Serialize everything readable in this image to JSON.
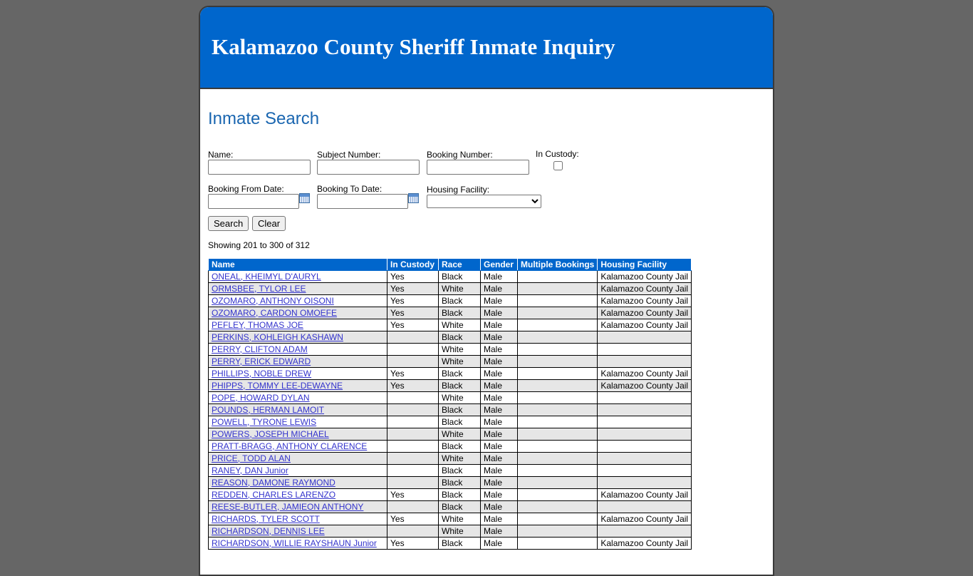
{
  "header": {
    "title": "Kalamazoo County Sheriff Inmate Inquiry"
  },
  "search": {
    "heading": "Inmate Search",
    "name_label": "Name:",
    "name_value": "",
    "subject_label": "Subject Number:",
    "subject_value": "",
    "booking_label": "Booking Number:",
    "booking_value": "",
    "custody_label": "In Custody:",
    "custody_checked": false,
    "from_label": "Booking From Date:",
    "from_value": "",
    "to_label": "Booking To Date:",
    "to_value": "",
    "facility_label": "Housing Facility:",
    "facility_selected": "",
    "search_button": "Search",
    "clear_button": "Clear",
    "calendar_icon": "calendar-icon"
  },
  "results": {
    "summary": "Showing 201 to 300 of 312",
    "columns": [
      "Name",
      "In Custody",
      "Race",
      "Gender",
      "Multiple Bookings",
      "Housing Facility"
    ],
    "rows": [
      {
        "name": "ONEAL, KHEIMYL D'AURYL",
        "custody": "Yes",
        "race": "Black",
        "gender": "Male",
        "multiple": "",
        "facility": "Kalamazoo County Jail"
      },
      {
        "name": "ORMSBEE, TYLOR LEE",
        "custody": "Yes",
        "race": "White",
        "gender": "Male",
        "multiple": "",
        "facility": "Kalamazoo County Jail"
      },
      {
        "name": "OZOMARO, ANTHONY OISONI",
        "custody": "Yes",
        "race": "Black",
        "gender": "Male",
        "multiple": "",
        "facility": "Kalamazoo County Jail"
      },
      {
        "name": "OZOMARO, CARDON OMOEFE",
        "custody": "Yes",
        "race": "Black",
        "gender": "Male",
        "multiple": "",
        "facility": "Kalamazoo County Jail"
      },
      {
        "name": "PEFLEY, THOMAS JOE",
        "custody": "Yes",
        "race": "White",
        "gender": "Male",
        "multiple": "",
        "facility": "Kalamazoo County Jail"
      },
      {
        "name": "PERKINS, KOHLEIGH KASHAWN",
        "custody": "",
        "race": "Black",
        "gender": "Male",
        "multiple": "",
        "facility": ""
      },
      {
        "name": "PERRY, CLIFTON ADAM",
        "custody": "",
        "race": "White",
        "gender": "Male",
        "multiple": "",
        "facility": ""
      },
      {
        "name": "PERRY, ERICK EDWARD",
        "custody": "",
        "race": "White",
        "gender": "Male",
        "multiple": "",
        "facility": ""
      },
      {
        "name": "PHILLIPS, NOBLE DREW",
        "custody": "Yes",
        "race": "Black",
        "gender": "Male",
        "multiple": "",
        "facility": "Kalamazoo County Jail"
      },
      {
        "name": "PHIPPS, TOMMY LEE-DEWAYNE",
        "custody": "Yes",
        "race": "Black",
        "gender": "Male",
        "multiple": "",
        "facility": "Kalamazoo County Jail"
      },
      {
        "name": "POPE, HOWARD DYLAN",
        "custody": "",
        "race": "White",
        "gender": "Male",
        "multiple": "",
        "facility": ""
      },
      {
        "name": "POUNDS, HERMAN LAMOIT",
        "custody": "",
        "race": "Black",
        "gender": "Male",
        "multiple": "",
        "facility": ""
      },
      {
        "name": "POWELL, TYRONE LEWIS",
        "custody": "",
        "race": "Black",
        "gender": "Male",
        "multiple": "",
        "facility": ""
      },
      {
        "name": "POWERS, JOSEPH MICHAEL",
        "custody": "",
        "race": "White",
        "gender": "Male",
        "multiple": "",
        "facility": ""
      },
      {
        "name": "PRATT-BRAGG, ANTHONY CLARENCE",
        "custody": "",
        "race": "Black",
        "gender": "Male",
        "multiple": "",
        "facility": ""
      },
      {
        "name": "PRICE, TODD ALAN",
        "custody": "",
        "race": "White",
        "gender": "Male",
        "multiple": "",
        "facility": ""
      },
      {
        "name": "RANEY, DAN Junior",
        "custody": "",
        "race": "Black",
        "gender": "Male",
        "multiple": "",
        "facility": ""
      },
      {
        "name": "REASON, DAMONE RAYMOND",
        "custody": "",
        "race": "Black",
        "gender": "Male",
        "multiple": "",
        "facility": ""
      },
      {
        "name": "REDDEN, CHARLES LARENZO",
        "custody": "Yes",
        "race": "Black",
        "gender": "Male",
        "multiple": "",
        "facility": "Kalamazoo County Jail"
      },
      {
        "name": "REESE-BUTLER, JAMIEON ANTHONY",
        "custody": "",
        "race": "Black",
        "gender": "Male",
        "multiple": "",
        "facility": ""
      },
      {
        "name": "RICHARDS, TYLER SCOTT",
        "custody": "Yes",
        "race": "White",
        "gender": "Male",
        "multiple": "",
        "facility": "Kalamazoo County Jail"
      },
      {
        "name": "RICHARDSON, DENNIS LEE",
        "custody": "",
        "race": "White",
        "gender": "Male",
        "multiple": "",
        "facility": ""
      },
      {
        "name": "RICHARDSON, WILLIE RAYSHAUN Junior",
        "custody": "Yes",
        "race": "Black",
        "gender": "Male",
        "multiple": "",
        "facility": "Kalamazoo County Jail"
      }
    ]
  }
}
